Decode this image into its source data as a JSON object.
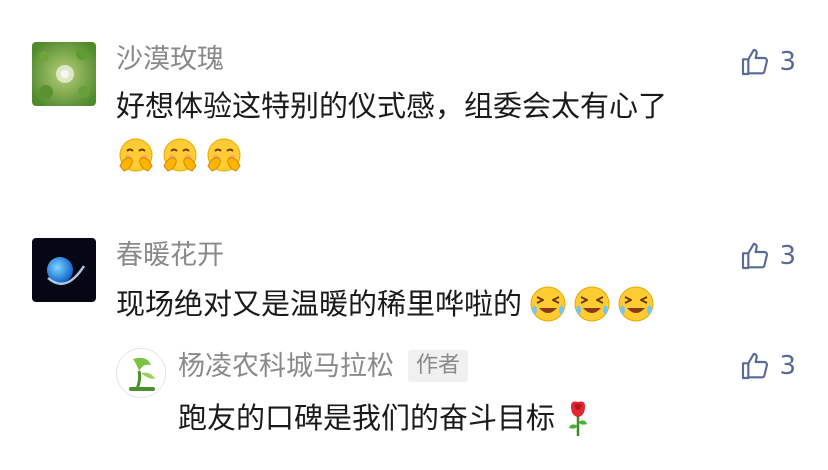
{
  "comments": [
    {
      "author": "沙漠玫瑰",
      "text": "好想体验这特别的仪式感，组委会太有心了",
      "likes": "3",
      "emoji": "hands-over-face-emoji"
    },
    {
      "author": "春暖花开",
      "text": "现场绝对又是温暖的稀里哗啦的",
      "likes": "3",
      "emoji": "crying-laughing-emoji"
    }
  ],
  "reply": {
    "author": "杨凌农科城马拉松",
    "author_tag": "作者",
    "text": "跑友的口碑是我们的奋斗目标",
    "likes": "3",
    "emoji": "rose-emoji"
  },
  "colors": {
    "name": "#8a8a8a",
    "text": "#1a1a1a",
    "like": "#576b95"
  }
}
